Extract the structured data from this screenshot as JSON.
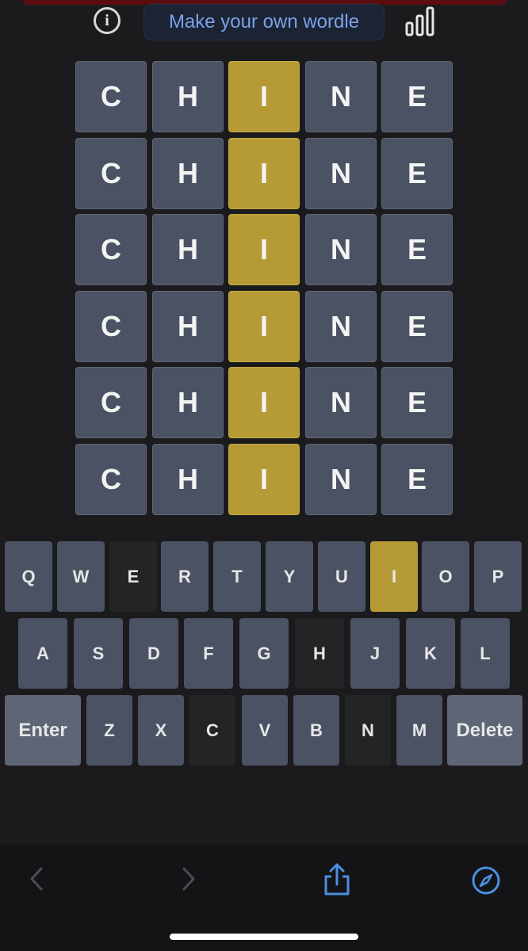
{
  "header": {
    "info_label": "i",
    "make_own_label": "Make your own wordle"
  },
  "board": {
    "rows": [
      [
        {
          "letter": "C",
          "state": "absent"
        },
        {
          "letter": "H",
          "state": "absent"
        },
        {
          "letter": "I",
          "state": "present"
        },
        {
          "letter": "N",
          "state": "absent"
        },
        {
          "letter": "E",
          "state": "absent"
        }
      ],
      [
        {
          "letter": "C",
          "state": "absent"
        },
        {
          "letter": "H",
          "state": "absent"
        },
        {
          "letter": "I",
          "state": "present"
        },
        {
          "letter": "N",
          "state": "absent"
        },
        {
          "letter": "E",
          "state": "absent"
        }
      ],
      [
        {
          "letter": "C",
          "state": "absent"
        },
        {
          "letter": "H",
          "state": "absent"
        },
        {
          "letter": "I",
          "state": "present"
        },
        {
          "letter": "N",
          "state": "absent"
        },
        {
          "letter": "E",
          "state": "absent"
        }
      ],
      [
        {
          "letter": "C",
          "state": "absent"
        },
        {
          "letter": "H",
          "state": "absent"
        },
        {
          "letter": "I",
          "state": "present"
        },
        {
          "letter": "N",
          "state": "absent"
        },
        {
          "letter": "E",
          "state": "absent"
        }
      ],
      [
        {
          "letter": "C",
          "state": "absent"
        },
        {
          "letter": "H",
          "state": "absent"
        },
        {
          "letter": "I",
          "state": "present"
        },
        {
          "letter": "N",
          "state": "absent"
        },
        {
          "letter": "E",
          "state": "absent"
        }
      ],
      [
        {
          "letter": "C",
          "state": "absent"
        },
        {
          "letter": "H",
          "state": "absent"
        },
        {
          "letter": "I",
          "state": "present"
        },
        {
          "letter": "N",
          "state": "absent"
        },
        {
          "letter": "E",
          "state": "absent"
        }
      ]
    ]
  },
  "keyboard": {
    "rows": [
      [
        {
          "label": "Q",
          "state": "unused"
        },
        {
          "label": "W",
          "state": "unused"
        },
        {
          "label": "E",
          "state": "absent"
        },
        {
          "label": "R",
          "state": "unused"
        },
        {
          "label": "T",
          "state": "unused"
        },
        {
          "label": "Y",
          "state": "unused"
        },
        {
          "label": "U",
          "state": "unused"
        },
        {
          "label": "I",
          "state": "present"
        },
        {
          "label": "O",
          "state": "unused"
        },
        {
          "label": "P",
          "state": "unused"
        }
      ],
      [
        {
          "label": "A",
          "state": "unused"
        },
        {
          "label": "S",
          "state": "unused"
        },
        {
          "label": "D",
          "state": "unused"
        },
        {
          "label": "F",
          "state": "unused"
        },
        {
          "label": "G",
          "state": "unused"
        },
        {
          "label": "H",
          "state": "absent"
        },
        {
          "label": "J",
          "state": "unused"
        },
        {
          "label": "K",
          "state": "unused"
        },
        {
          "label": "L",
          "state": "unused"
        }
      ],
      [
        {
          "label": "Enter",
          "state": "action"
        },
        {
          "label": "Z",
          "state": "unused"
        },
        {
          "label": "X",
          "state": "unused"
        },
        {
          "label": "C",
          "state": "absent"
        },
        {
          "label": "V",
          "state": "unused"
        },
        {
          "label": "B",
          "state": "unused"
        },
        {
          "label": "N",
          "state": "absent"
        },
        {
          "label": "M",
          "state": "unused"
        },
        {
          "label": "Delete",
          "state": "action"
        }
      ]
    ]
  },
  "browser_bar": {
    "icons": [
      "back-icon",
      "forward-icon",
      "share-icon",
      "compass-icon"
    ]
  },
  "colors": {
    "background": "#1b1b1d",
    "tile_absent": "#4b5263",
    "tile_present": "#b59a35",
    "key_absent": "#232425",
    "link_blue": "#4a90e2"
  }
}
